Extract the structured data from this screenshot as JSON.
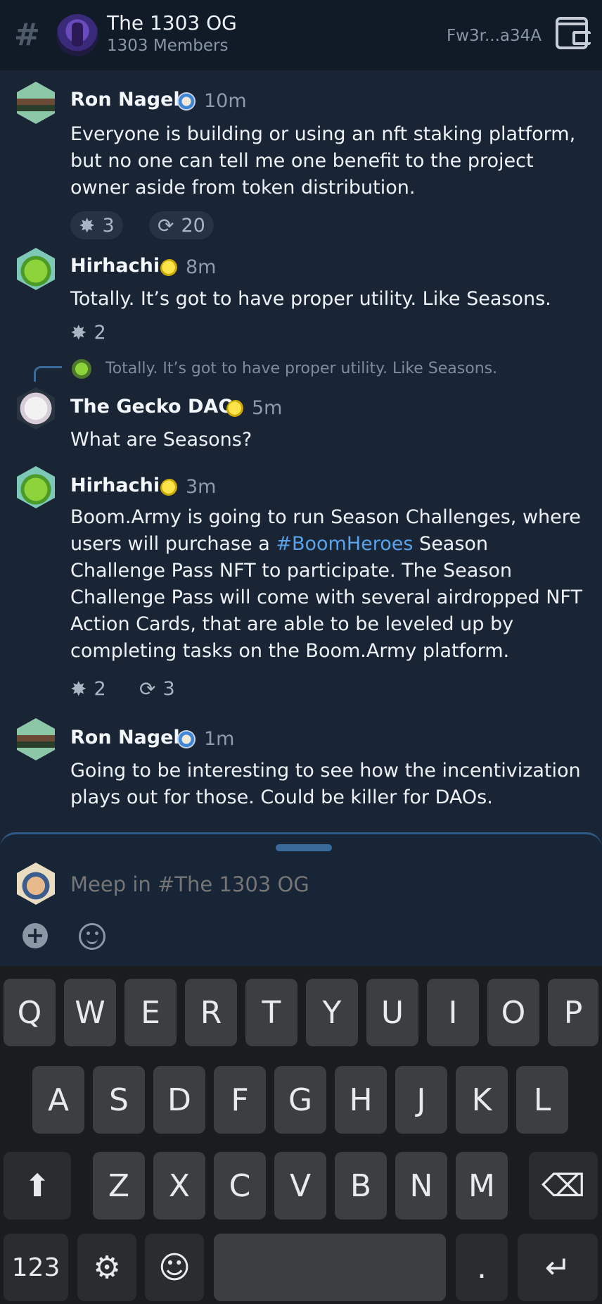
{
  "header": {
    "channel_name": "The 1303 OG",
    "member_count": "1303 Members",
    "wallet_address": "Fw3r...a34A"
  },
  "messages": [
    {
      "author": "Ron Nagel",
      "time": "10m",
      "text": "Everyone is building or using an nft staking platform, but no one can tell me one benefit to the project owner aside from token distribution.",
      "reactions": [
        {
          "icon": "boom-icon",
          "count": "3"
        },
        {
          "icon": "tip-icon",
          "count": "20"
        }
      ]
    },
    {
      "author": "Hirhachi",
      "time": "8m",
      "text": "Totally. It’s got to have proper utility. Like Seasons.",
      "reactions": [
        {
          "icon": "boom-icon",
          "count": "2"
        }
      ]
    },
    {
      "reply_preview": "Totally. It’s got to have proper utility. Like Seasons.",
      "author": "The Gecko DAO",
      "time": "5m",
      "text": "What are Seasons?"
    },
    {
      "author": "Hirhachi",
      "time": "3m",
      "text_before": "Boom.Army is going to run Season Challenges, where users will purchase a ",
      "hashtag": "#BoomHeroes",
      "text_after": " Season Challenge Pass NFT to participate. The Season Challenge Pass will come with several airdropped NFT Action Cards, that are able to be leveled up by completing tasks on the Boom.Army platform.",
      "reactions": [
        {
          "icon": "boom-icon",
          "count": "2"
        },
        {
          "icon": "tip-icon",
          "count": "3"
        }
      ]
    },
    {
      "author": "Ron Nagel",
      "time": "1m",
      "text": "Going to be interesting to see how the incentivization plays out for those. Could be killer for DAOs."
    }
  ],
  "composer": {
    "placeholder": "Meep in #The 1303 OG"
  },
  "keyboard": {
    "row1": [
      "Q",
      "W",
      "E",
      "R",
      "T",
      "Y",
      "U",
      "I",
      "O",
      "P"
    ],
    "row2": [
      "A",
      "S",
      "D",
      "F",
      "G",
      "H",
      "J",
      "K",
      "L"
    ],
    "row3": [
      "Z",
      "X",
      "C",
      "V",
      "B",
      "N",
      "M"
    ],
    "numbers_label": "123",
    "period": "."
  }
}
